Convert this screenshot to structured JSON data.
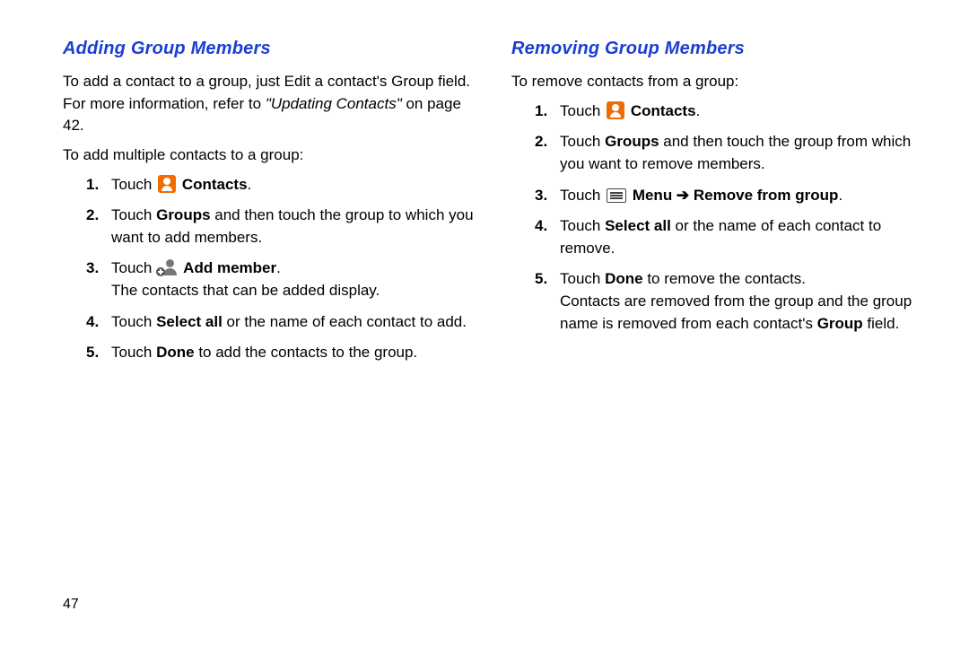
{
  "page_number": "47",
  "left": {
    "heading": "Adding Group Members",
    "intro_1a": "To add a contact to a group, just Edit a contact's Group field. For more information, refer to ",
    "intro_1_ref": "\"Updating Contacts\"",
    "intro_1b": " on page 42.",
    "intro_2": "To add multiple contacts to a group:",
    "s1_touch": "Touch ",
    "s1_label": " Contacts",
    "s1_end": ".",
    "s2_a": "Touch ",
    "s2_groups": "Groups",
    "s2_b": " and then touch the group to which you want to add members.",
    "s3_touch": "Touch ",
    "s3_label": " Add member",
    "s3_end": ".",
    "s3_line2": "The contacts that can be added display.",
    "s4_a": "Touch ",
    "s4_sa": "Select all",
    "s4_b": " or the name of each contact to add.",
    "s5_a": "Touch ",
    "s5_done": "Done",
    "s5_b": " to add the contacts to the group."
  },
  "right": {
    "heading": "Removing Group Members",
    "intro": "To remove contacts from a group:",
    "s1_touch": "Touch ",
    "s1_label": " Contacts",
    "s1_end": ".",
    "s2_a": "Touch ",
    "s2_groups": "Groups",
    "s2_b": " and then touch the group from which you want to remove members.",
    "s3_touch": "Touch ",
    "s3_menu": " Menu",
    "s3_arrow": " ➔ ",
    "s3_remove": "Remove from group",
    "s3_end": ".",
    "s4_a": "Touch ",
    "s4_sa": "Select all",
    "s4_b": " or the name of each contact to remove.",
    "s5_a": "Touch ",
    "s5_done": "Done",
    "s5_b": " to remove the contacts.",
    "s5_line2a": "Contacts are removed from the group and the group name is removed from each contact's ",
    "s5_line2_group": "Group",
    "s5_line2b": " field."
  }
}
